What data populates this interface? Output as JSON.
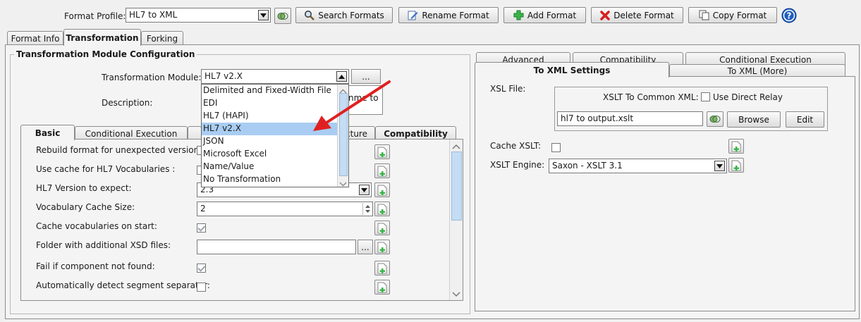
{
  "header": {
    "format_profile_label": "Format Profile:",
    "format_profile_value": "HL7 to XML",
    "buttons": {
      "search": "Search Formats",
      "rename": "Rename Format",
      "add": "Add Format",
      "delete": "Delete Format",
      "copy": "Copy Format"
    }
  },
  "main_tabs": [
    "Format Info",
    "Transformation",
    "Forking"
  ],
  "left": {
    "group_title": "Transformation Module Configuration",
    "module_label": "Transformation Module:",
    "module_value": "HL7 v2.X",
    "module_button": "...",
    "description_label": "Description:",
    "description_visible": "nme to",
    "dropdown_options": [
      "Delimited and Fixed-Width File",
      "EDI",
      "HL7 (HAPI)",
      "HL7 v2.X",
      "JSON",
      "Microsoft Excel",
      "Name/Value",
      "No Transformation"
    ],
    "sub_tabs": [
      "Basic",
      "Conditional Execution",
      "",
      "ucture",
      "Compatibility"
    ],
    "rows": {
      "rebuild": "Rebuild format for unexpected version:",
      "use_cache": "Use cache for HL7 Vocabularies  :",
      "version": "HL7 Version to expect:",
      "version_value": "2.3",
      "vocab_size": "Vocabulary Cache Size:",
      "vocab_size_value": "2",
      "cache_on_start": "Cache vocabularies on start:",
      "folder_xsd": "Folder with additional XSD files:",
      "folder_button": "...",
      "fail_not_found": "Fail if component not found:",
      "auto_detect": "Automatically detect segment separator:"
    }
  },
  "right": {
    "tabs_row1": [
      "Advanced",
      "Compatibility",
      "Conditional Execution"
    ],
    "tabs_row2": [
      "To XML Settings",
      "To XML (More)"
    ],
    "xsl_file_label": "XSL File:",
    "xslt_common_label": "XSLT To Common XML:",
    "use_direct_relay": "Use Direct Relay",
    "xsl_file_value": "hl7 to output.xslt",
    "browse": "Browse",
    "edit": "Edit",
    "cache_xslt": "Cache XSLT:",
    "xslt_engine": "XSLT Engine:",
    "xslt_engine_value": "Saxon - XSLT 3.1"
  },
  "colors": {
    "selection": "#a9cdf2",
    "arrow": "#e02020",
    "help": "#1f5fbf"
  }
}
